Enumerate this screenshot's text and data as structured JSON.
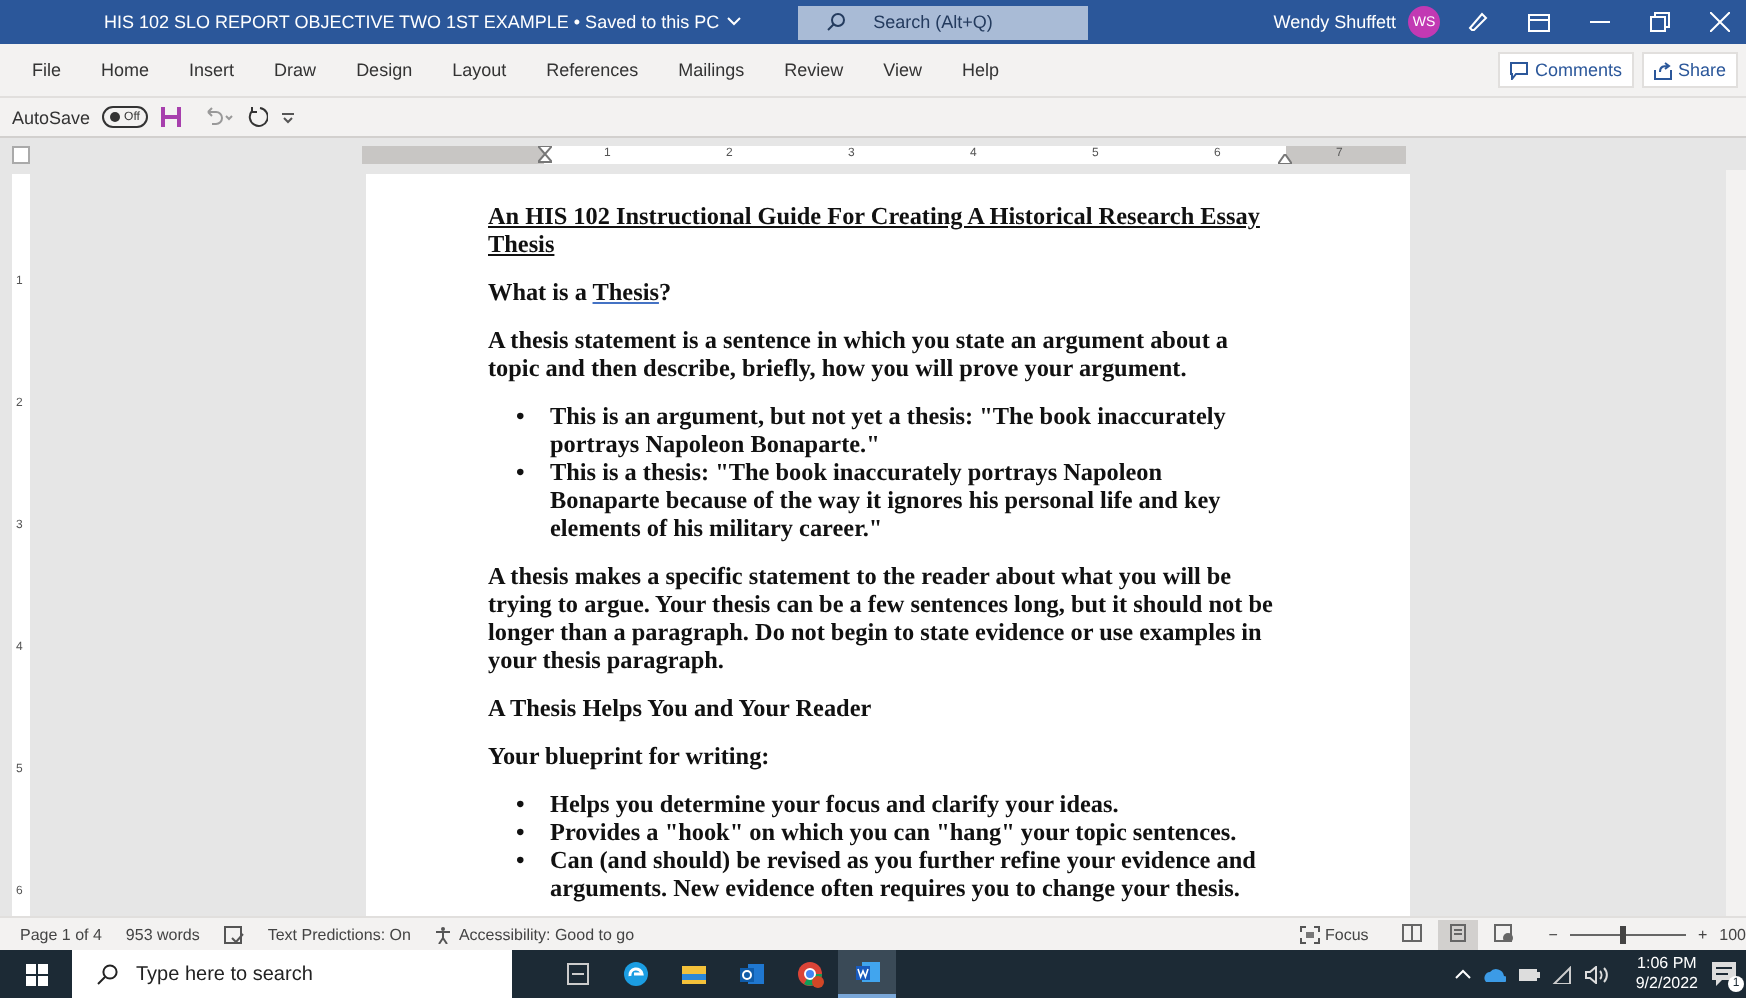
{
  "window": {
    "title": "HIS 102 SLO REPORT OBJECTIVE TWO 1ST EXAMPLE • Saved to this PC",
    "search_placeholder": "Search (Alt+Q)",
    "user_name": "Wendy Shuffett",
    "user_initials": "WS"
  },
  "ribbon": {
    "tabs": [
      {
        "label": "File"
      },
      {
        "label": "Home"
      },
      {
        "label": "Insert"
      },
      {
        "label": "Draw"
      },
      {
        "label": "Design"
      },
      {
        "label": "Layout"
      },
      {
        "label": "References"
      },
      {
        "label": "Mailings"
      },
      {
        "label": "Review"
      },
      {
        "label": "View"
      },
      {
        "label": "Help"
      }
    ],
    "buttons": [
      {
        "kind": "comments",
        "label": "Comments"
      },
      {
        "kind": "share",
        "label": "Share"
      }
    ]
  },
  "quick_access": {
    "autosave_label": "AutoSave",
    "autosave": {
      "on": false,
      "label": "Off"
    }
  },
  "ruler": {
    "numbers": [
      "1",
      "2",
      "3",
      "4",
      "5",
      "6",
      "7"
    ],
    "vertical_numbers": [
      "1",
      "2",
      "3",
      "4",
      "5",
      "6"
    ]
  },
  "document": {
    "blocks": [
      {
        "kind": "title",
        "text": "An HIS 102 Instructional Guide For Creating A Historical Research Essay Thesis"
      },
      {
        "kind": "heading",
        "parts": [
          {
            "text": "What is a ",
            "underlined": false
          },
          {
            "text": "Thesis",
            "underlined": true
          },
          {
            "text": "?",
            "underlined": false
          }
        ]
      },
      {
        "kind": "paragraph",
        "text": "A thesis statement is a sentence in which you state an argument about a topic and then describe, briefly, how you will prove your argument."
      },
      {
        "kind": "bullets",
        "marker": "•",
        "items": [
          "This is an argument, but not yet a thesis: \"The book inaccurately portrays Napoleon Bonaparte.\"",
          "This is a thesis: \"The book inaccurately portrays Napoleon Bonaparte because of the way it ignores his personal life and key elements of his military career.\""
        ]
      },
      {
        "kind": "paragraph",
        "text": "A thesis makes a specific statement to the reader about what you will be trying to argue. Your thesis can be a few sentences long, but it should not be longer than a paragraph. Do not begin to state evidence or use examples in your thesis paragraph."
      },
      {
        "kind": "paragraph",
        "text": "A Thesis Helps You and Your Reader"
      },
      {
        "kind": "paragraph",
        "text": "Your blueprint for writing:"
      },
      {
        "kind": "bullets",
        "marker": "•",
        "items": [
          "Helps you determine your focus and clarify your ideas.",
          "Provides a \"hook\" on which you can \"hang\" your topic sentences.",
          "Can (and should) be revised as you further refine your evidence and arguments. New evidence often requires you to change your thesis."
        ]
      }
    ]
  },
  "status_bar": {
    "page": "Page 1 of 4",
    "words": "953 words",
    "text_predictions": "Text Predictions: On",
    "accessibility": "Accessibility: Good to go",
    "focus": "Focus",
    "views": [
      {
        "kind": "read",
        "selected": false
      },
      {
        "kind": "print",
        "selected": true
      },
      {
        "kind": "web",
        "selected": false
      }
    ],
    "zoom": {
      "minus": "−",
      "plus": "+",
      "level": 0.45,
      "reading": "100"
    }
  },
  "taskbar": {
    "search_placeholder": "Type here to search",
    "apps": [
      {
        "kind": "taskview",
        "selected": false
      },
      {
        "kind": "edge",
        "selected": false
      },
      {
        "kind": "explorer",
        "selected": false
      },
      {
        "kind": "outlook",
        "selected": false
      },
      {
        "kind": "chrome",
        "selected": false
      },
      {
        "kind": "word",
        "selected": true
      }
    ],
    "time": "1:06 PM",
    "date": "9/2/2022",
    "notifications": "1"
  }
}
